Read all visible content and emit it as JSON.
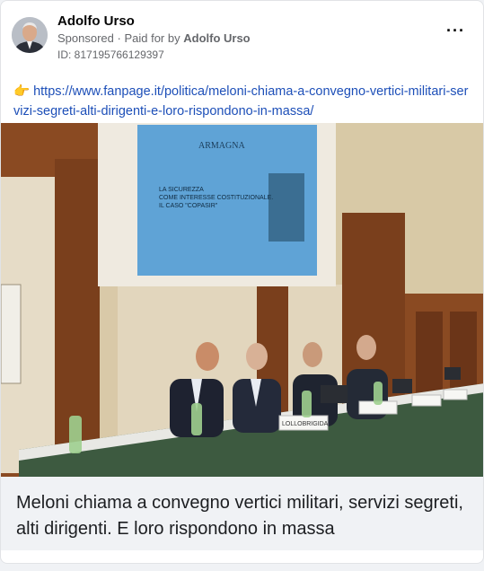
{
  "post": {
    "author": "Adolfo Urso",
    "sponsored_label": "Sponsored",
    "paid_for_prefix": "· Paid for by",
    "paid_for_name": "Adolfo Urso",
    "ad_id": "ID: 817195766129397",
    "more_icon": "more-options-icon",
    "pointing_emoji": "👉",
    "link_url": "https://www.fanpage.it/politica/meloni-chiama-a-convegno-vertici-militari-servizi-segreti-alti-dirigenti-e-loro-rispondono-in-massa/"
  },
  "photo": {
    "screen_text": {
      "logo": "ARMAGNA",
      "title": "LA SICUREZZA COME INTERESSE COSTITUZIONALE. IL CASO \"COPASIR\""
    },
    "nameplate": "LOLLOBRIGIDA"
  },
  "headline": {
    "text": "Meloni chiama a convegno vertici militari, servizi segreti, alti dirigenti. E loro rispondono in massa"
  },
  "colors": {
    "link": "#1d4fb8",
    "headline_bg": "#f0f2f5",
    "wood": "#6b3b1c"
  }
}
